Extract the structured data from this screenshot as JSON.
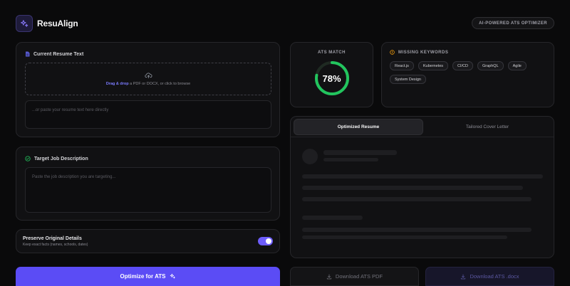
{
  "app": {
    "name": "ResuAlign",
    "tagline": "AI-POWERED ATS OPTIMIZER",
    "logo_icon": "sparkles-icon"
  },
  "resume": {
    "title": "Current Resume Text",
    "icon": "document-icon",
    "drop_highlight": "Drag & drop",
    "drop_text": "a PDF or DOCX, or click to browse",
    "paste_placeholder": "...or paste your resume text here directly"
  },
  "job": {
    "title": "Target Job Description",
    "icon": "check-circle-icon",
    "placeholder": "Paste the job description you are targeting..."
  },
  "preserve": {
    "title": "Preserve Original Details",
    "subtitle": "Keep exact facts (names, schools, dates)",
    "enabled": true
  },
  "optimize_button": "Optimize for ATS",
  "ats": {
    "label": "ATS MATCH",
    "score": 78,
    "score_text": "78%",
    "color": "#22c55e"
  },
  "missing_keywords": {
    "title": "MISSING KEYWORDS",
    "icon_color": "#f59e0b",
    "items": [
      "React.js",
      "Kubernetes",
      "CI/CD",
      "GraphQL",
      "Agile",
      "System Design"
    ]
  },
  "preview": {
    "tabs": [
      {
        "label": "Optimized Resume",
        "active": true
      },
      {
        "label": "Tailored Cover Letter",
        "active": false
      }
    ]
  },
  "downloads": {
    "pdf": "Download ATS PDF",
    "docx": "Download ATS .docx"
  },
  "colors": {
    "accent": "#5b4cf5",
    "background": "#0a0a0b",
    "card": "#111113"
  }
}
